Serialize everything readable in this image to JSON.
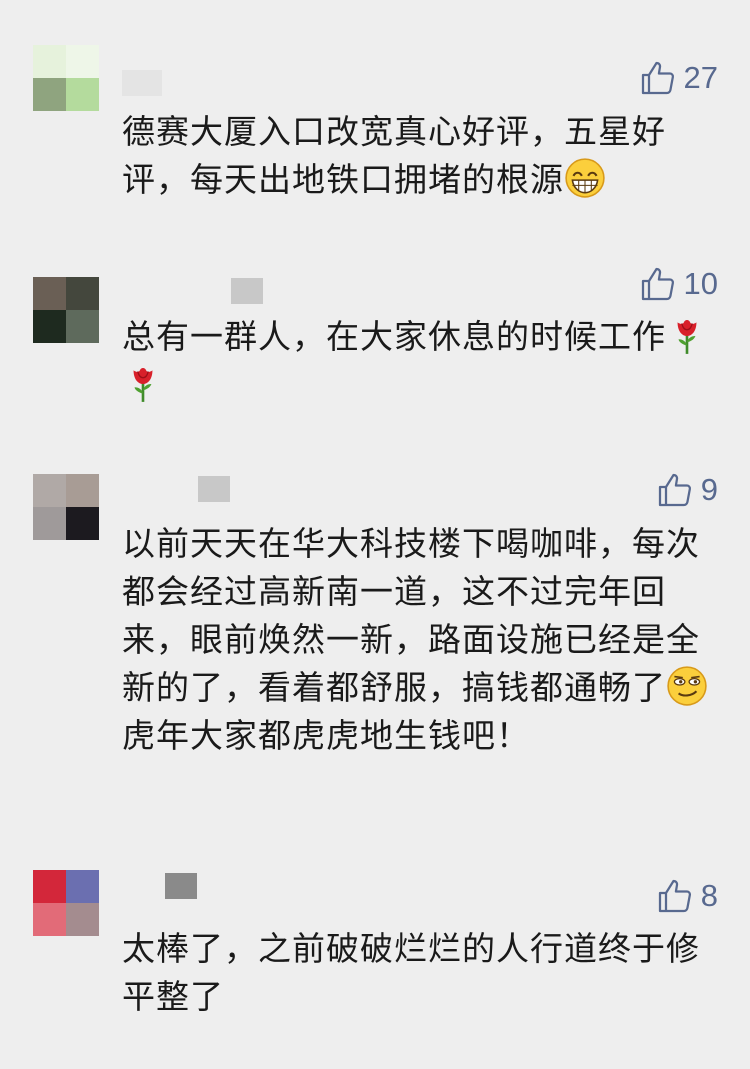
{
  "comments": [
    {
      "likes": "27",
      "text_parts": [
        "德赛大厦入口改宽真心好评，五星好评，每天出地铁口拥堵的根源",
        ""
      ],
      "emoji": "grinning-face-icon"
    },
    {
      "likes": "10",
      "text_parts": [
        "总有一群人，在大家休息的时候工作",
        ""
      ],
      "emoji": "rose-icon"
    },
    {
      "likes": "9",
      "text_parts": [
        "以前天天在华大科技楼下喝咖啡，每次都会经过高新南一道，这不过完年回来，眼前焕然一新，路面设施已经是全新的了，看着都舒服，搞钱都通畅了",
        "虎年大家都虎虎地生钱吧！"
      ],
      "emoji": "smirking-face-icon"
    },
    {
      "likes": "8",
      "text_parts": [
        "太棒了，之前破破烂烂的人行道终于修平整了",
        ""
      ],
      "emoji": ""
    }
  ],
  "colors": {
    "background": "#eeeeee",
    "like_color": "#58698f",
    "text_color": "#1a1a1a"
  }
}
